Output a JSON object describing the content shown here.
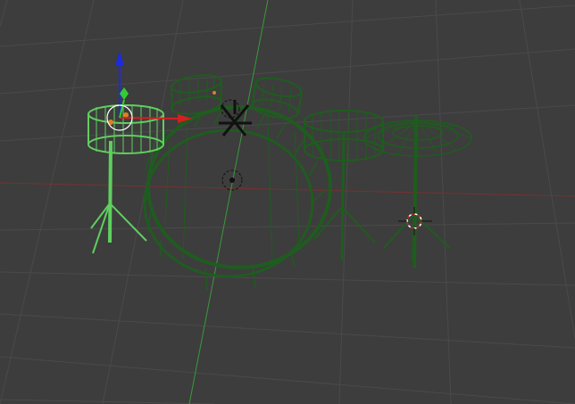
{
  "viewport": {
    "mode": "3d-view-wireframe",
    "background": "#3d3d3d",
    "grid_color": "#4b4b4b",
    "axis_x_color": "#8a3a3a",
    "axis_y_color": "#3f9a3f"
  },
  "scene": {
    "objects": [
      {
        "name": "bass-drum",
        "selected": false
      },
      {
        "name": "tom-left",
        "selected": false
      },
      {
        "name": "tom-right",
        "selected": false
      },
      {
        "name": "snare-drum",
        "selected": true
      },
      {
        "name": "floor-drum",
        "selected": false
      },
      {
        "name": "ride-cymbal",
        "selected": false
      }
    ],
    "colors": {
      "wire_unselected": "#1f5c1f",
      "wire_selected": "#5fcf5f",
      "gizmo_x": "#d42020",
      "gizmo_y": "#33cc33",
      "gizmo_z": "#1c2ae0"
    }
  },
  "widgets": {
    "transform_gizmo": "translate-manipulator",
    "origin_markers": "object-origin-icon",
    "cursor_3d": "3d-cursor-icon",
    "camera_icon": "camera-object-icon"
  }
}
